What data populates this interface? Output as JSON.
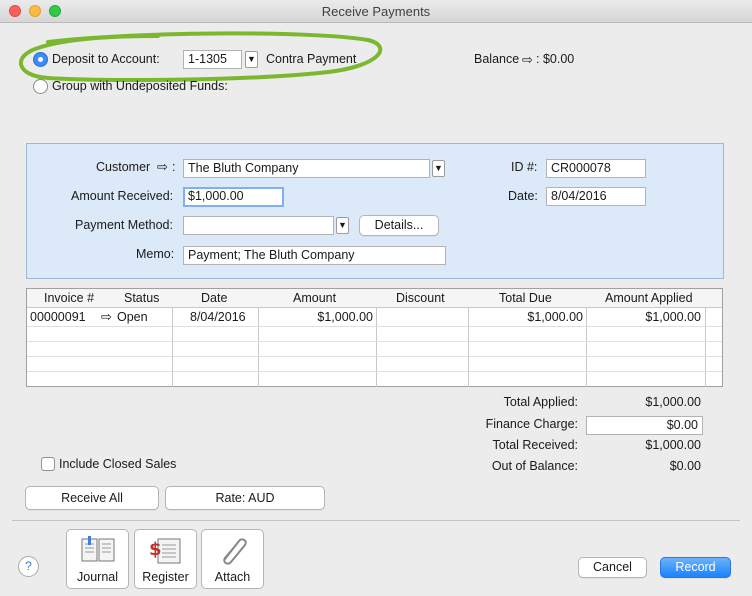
{
  "window": {
    "title": "Receive Payments"
  },
  "deposit": {
    "deposit_label": "Deposit to Account:",
    "account_number": "1-1305",
    "account_name": "Contra Payment",
    "group_label": "Group with Undeposited Funds:",
    "balance_label": "Balance",
    "balance_value": ": $0.00"
  },
  "form": {
    "customer_label": "Customer",
    "customer_colon": ":",
    "customer_value": "The Bluth Company",
    "amount_label": "Amount Received:",
    "amount_value": "$1,000.00",
    "method_label": "Payment Method:",
    "method_value": "",
    "details_button": "Details...",
    "memo_label": "Memo:",
    "memo_value": "Payment; The Bluth Company",
    "id_label": "ID #:",
    "id_value": "CR000078",
    "date_label": "Date:",
    "date_value": "8/04/2016"
  },
  "table": {
    "columns": [
      "Invoice #",
      "Status",
      "Date",
      "Amount",
      "Discount",
      "Total Due",
      "Amount Applied"
    ],
    "rows": [
      {
        "invoice": "00000091",
        "status": "Open",
        "date": "8/04/2016",
        "amount": "$1,000.00",
        "discount": "",
        "total_due": "$1,000.00",
        "applied": "$1,000.00"
      }
    ]
  },
  "totals": {
    "applied_label": "Total Applied:",
    "applied_value": "$1,000.00",
    "finance_label": "Finance Charge:",
    "finance_value": "$0.00",
    "received_label": "Total Received:",
    "received_value": "$1,000.00",
    "oob_label": "Out of Balance:",
    "oob_value": "$0.00"
  },
  "options": {
    "include_closed_label": "Include Closed Sales",
    "receive_all_button": "Receive All",
    "rate_button": "Rate:  AUD"
  },
  "toolbar": {
    "help": "?",
    "journal": "Journal",
    "register": "Register",
    "attach": "Attach"
  },
  "actions": {
    "cancel": "Cancel",
    "record": "Record"
  },
  "colors": {
    "highlight_circle": "#7cb82f",
    "panel": "#dbe9f9",
    "primary": "#1a82fb"
  },
  "icons": [
    "arrow-right-icon",
    "dropdown-icon",
    "journal-icon",
    "register-icon",
    "attach-icon",
    "help-icon"
  ]
}
